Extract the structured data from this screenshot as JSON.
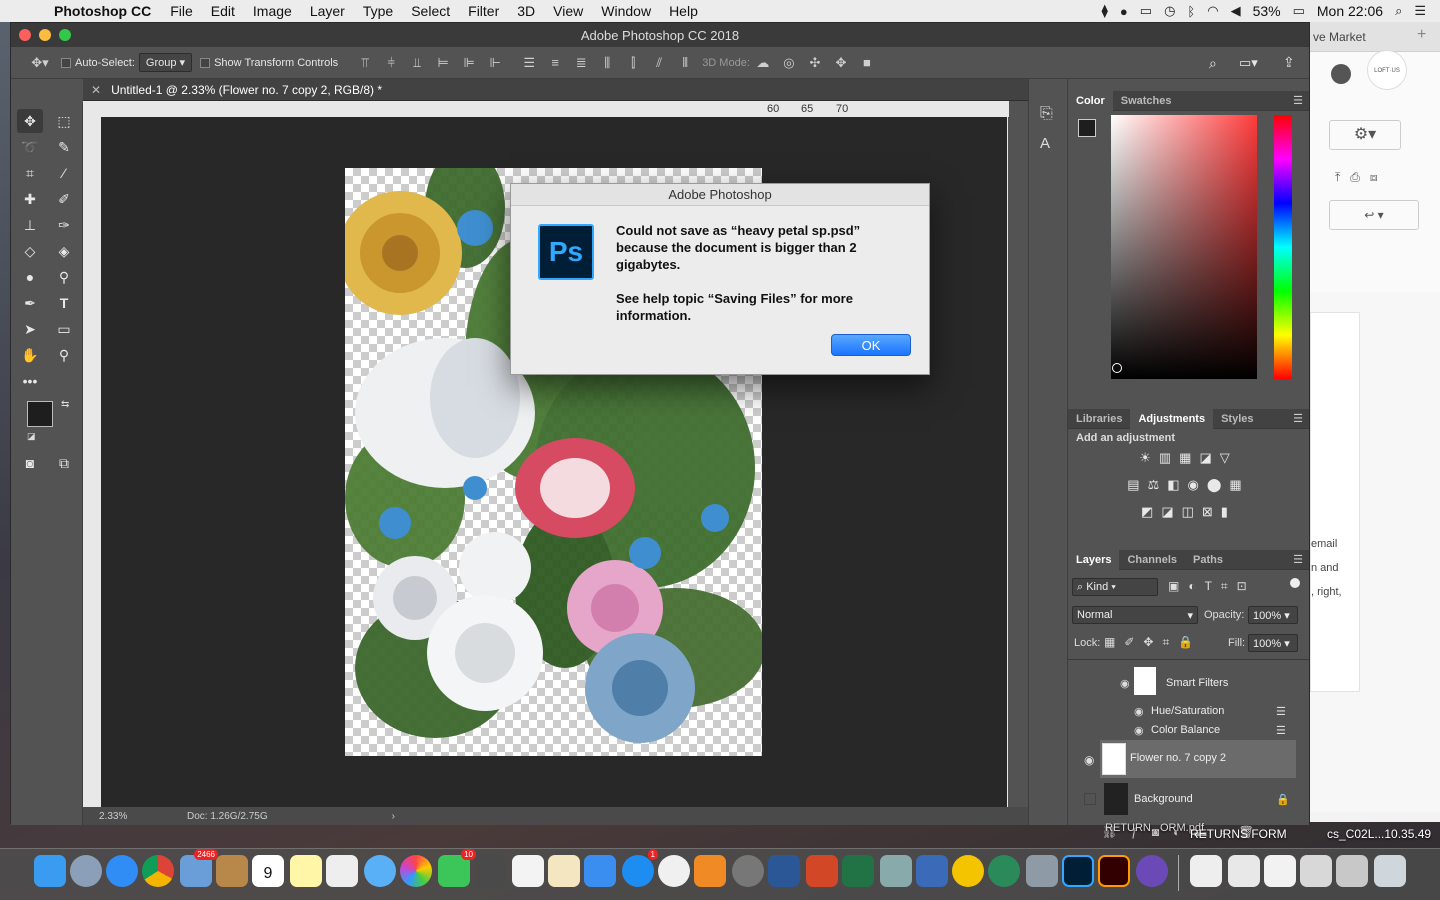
{
  "menubar": {
    "app": "Photoshop CC",
    "items": [
      "File",
      "Edit",
      "Image",
      "Layer",
      "Type",
      "Select",
      "Filter",
      "3D",
      "View",
      "Window",
      "Help"
    ],
    "battery": "53%",
    "clock": "Mon 22:06"
  },
  "window": {
    "title": "Adobe Photoshop CC 2018"
  },
  "options": {
    "auto_select": "Auto-Select:",
    "group": "Group",
    "show_transform": "Show Transform Controls",
    "mode3d": "3D Mode:"
  },
  "document": {
    "tab": "Untitled-1 @ 2.33% (Flower no. 7 copy 2, RGB/8) *",
    "zoom": "2.33%",
    "doc_info": "Doc: 1.26G/2.75G",
    "ruler": [
      "60",
      "65",
      "70"
    ]
  },
  "panels": {
    "color_tabs": [
      "Color",
      "Swatches"
    ],
    "adj_tabs": [
      "Libraries",
      "Adjustments",
      "Styles"
    ],
    "add_adjustment": "Add an adjustment",
    "layer_tabs": [
      "Layers",
      "Channels",
      "Paths"
    ],
    "kind": "Kind",
    "blend": "Normal",
    "opacity_label": "Opacity:",
    "opacity": "100%",
    "lock_label": "Lock:",
    "fill_label": "Fill:",
    "fill": "100%",
    "layers": {
      "smart_filters": "Smart Filters",
      "hue": "Hue/Saturation",
      "color_balance": "Color Balance",
      "flower": "Flower no. 7 copy 2",
      "background": "Background"
    }
  },
  "dialog": {
    "title": "Adobe Photoshop",
    "message": "Could not save as “heavy petal sp.psd” because the document is bigger than 2 gigabytes.\n\nSee help topic “Saving Files” for more information.",
    "ok": "OK",
    "icon": "Ps"
  },
  "browser": {
    "tab": "ve Market",
    "badge": "LOFT·US",
    "lines": [
      "email",
      "n and",
      ", right,"
    ]
  },
  "desktop": {
    "returns1": "RETURN...ORM.pdf",
    "returns2": "RETURNS FORM",
    "file": "cs_C02L...10.35.49"
  },
  "dock": {
    "badge_mail": "2466",
    "badge_msg": "10",
    "badge_app": "1",
    "cal_day": "9"
  },
  "colors": {
    "accent": "#1a74ff",
    "ps_blue": "#31a8ff",
    "panel_bg": "#535353"
  }
}
